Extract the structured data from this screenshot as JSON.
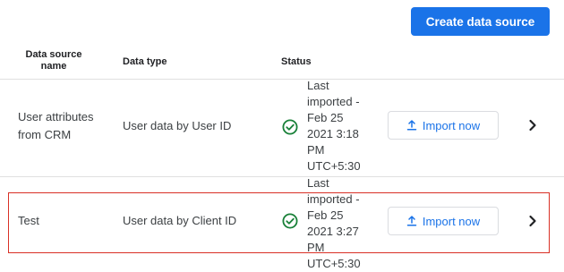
{
  "toolbar": {
    "create_label": "Create data source"
  },
  "table": {
    "headers": {
      "name": "Data source name",
      "type": "Data type",
      "status": "Status"
    },
    "rows": [
      {
        "name": "User attributes from CRM",
        "type": "User data by User ID",
        "status_lines": [
          "Last",
          "imported -",
          "Feb 25",
          "2021 3:18",
          "PM",
          "UTC+5:30"
        ],
        "status_icon": "check-circle-icon",
        "action_label": "Import now",
        "selected": false
      },
      {
        "name": "Test",
        "type": "User data by Client ID",
        "status_lines": [
          "Last",
          "imported -",
          "Feb 25",
          "2021 3:27",
          "PM",
          "UTC+5:30"
        ],
        "status_icon": "check-circle-icon",
        "action_label": "Import now",
        "selected": true
      }
    ]
  },
  "colors": {
    "accent": "#1a73e8",
    "success": "#188038",
    "highlight": "#d93025",
    "divider": "#e0e0e0"
  }
}
